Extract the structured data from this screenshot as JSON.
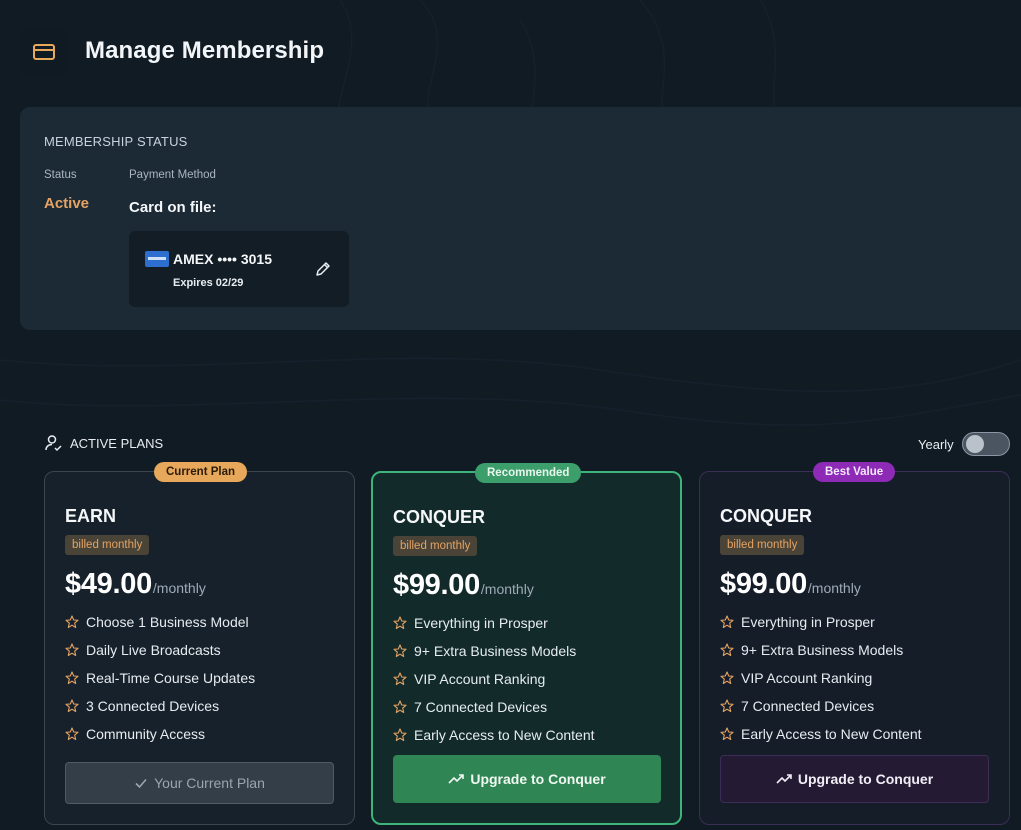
{
  "header": {
    "title": "Manage Membership",
    "icon": "credit-card-icon",
    "icon_color": "#e7a85b"
  },
  "membership": {
    "heading": "MEMBERSHIP STATUS",
    "status_label": "Status",
    "status_value": "Active",
    "payment_label": "Payment Method",
    "card_on_file": "Card on file:",
    "card": {
      "brand_icon": "amex-card-icon",
      "number": "AMEX •••• 3015",
      "expires": "Expires 02/29",
      "edit_icon": "pencil-icon"
    }
  },
  "plans_section": {
    "title": "ACTIVE PLANS",
    "icon": "user-check-icon",
    "yearly_label": "Yearly",
    "yearly_on": false
  },
  "plans": [
    {
      "badge": "Current Plan",
      "name": "EARN",
      "billing": "billed monthly",
      "price": "$49.00",
      "period": "/monthly",
      "features": [
        "Choose 1 Business Model",
        "Daily Live Broadcasts",
        "Real-Time Course Updates",
        "3 Connected Devices",
        "Community Access"
      ],
      "button": "Your Current Plan",
      "button_icon": "check-icon"
    },
    {
      "badge": "Recommended",
      "name": "CONQUER",
      "billing": "billed monthly",
      "price": "$99.00",
      "period": "/monthly",
      "features": [
        "Everything in Prosper",
        "9+ Extra Business Models",
        "VIP Account Ranking",
        "7 Connected Devices",
        "Early Access to New Content"
      ],
      "button": "Upgrade to Conquer",
      "button_icon": "trending-up-icon"
    },
    {
      "badge": "Best Value",
      "name": "CONQUER",
      "billing": "billed monthly",
      "price": "$99.00",
      "period": "/monthly",
      "features": [
        "Everything in Prosper",
        "9+ Extra Business Models",
        "VIP Account Ranking",
        "7 Connected Devices",
        "Early Access to New Content"
      ],
      "button": "Upgrade to Conquer",
      "button_icon": "trending-up-icon"
    }
  ],
  "colors": {
    "accent_orange": "#e7a85b",
    "green": "#3eb37a",
    "purple": "#8d2ab6",
    "star": "#e4a363"
  }
}
